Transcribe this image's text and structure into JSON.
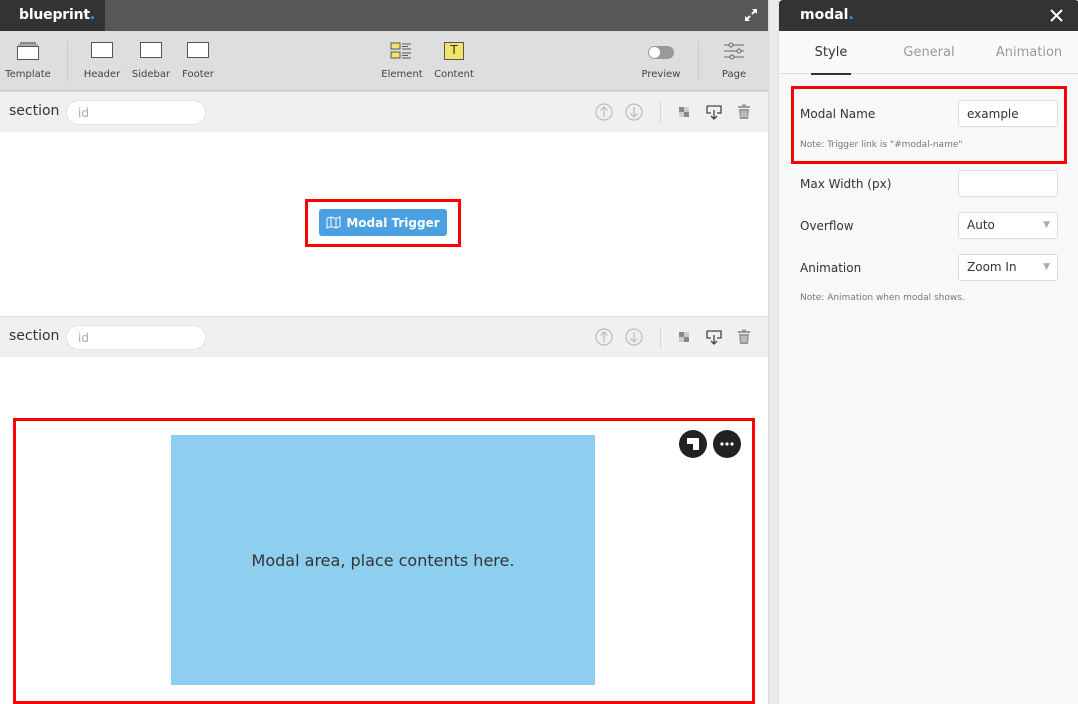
{
  "app": {
    "brand": "blueprint",
    "brand_dot": "."
  },
  "toolbar": {
    "items": [
      {
        "label": "Template",
        "icon": "template-icon"
      },
      {
        "label": "Header",
        "icon": "header-icon"
      },
      {
        "label": "Sidebar",
        "icon": "sidebar-icon"
      },
      {
        "label": "Footer",
        "icon": "footer-icon"
      },
      {
        "label": "Element",
        "icon": "element-icon"
      },
      {
        "label": "Content",
        "icon": "content-icon",
        "glyph": "T"
      },
      {
        "label": "Preview",
        "icon": "toggle-icon",
        "toggled": false
      },
      {
        "label": "Page",
        "icon": "sliders-icon"
      }
    ]
  },
  "sections": [
    {
      "label": "section",
      "id_placeholder": "id",
      "id_value": ""
    },
    {
      "label": "section",
      "id_placeholder": "id",
      "id_value": ""
    }
  ],
  "canvas": {
    "trigger_button": "Modal Trigger",
    "modal_text": "Modal area, place contents here."
  },
  "panel": {
    "title": "modal",
    "title_dot": ".",
    "tabs": [
      {
        "label": "Style",
        "active": true
      },
      {
        "label": "General",
        "active": false
      },
      {
        "label": "Animation",
        "active": false
      }
    ],
    "fields": {
      "modal_name": {
        "label": "Modal Name",
        "value": "example",
        "note": "Note: Trigger link is \"#modal-name\""
      },
      "max_width": {
        "label": "Max Width (px)",
        "value": ""
      },
      "overflow": {
        "label": "Overflow",
        "value": "Auto"
      },
      "animation": {
        "label": "Animation",
        "value": "Zoom In",
        "note": "Note: Animation when modal shows."
      }
    }
  },
  "colors": {
    "accent": "#3b9be0",
    "trigger_button": "#4aa0e0",
    "modal_area": "#8ecff0",
    "highlight": "#ff0000",
    "content_tool": "#f2e36a"
  }
}
